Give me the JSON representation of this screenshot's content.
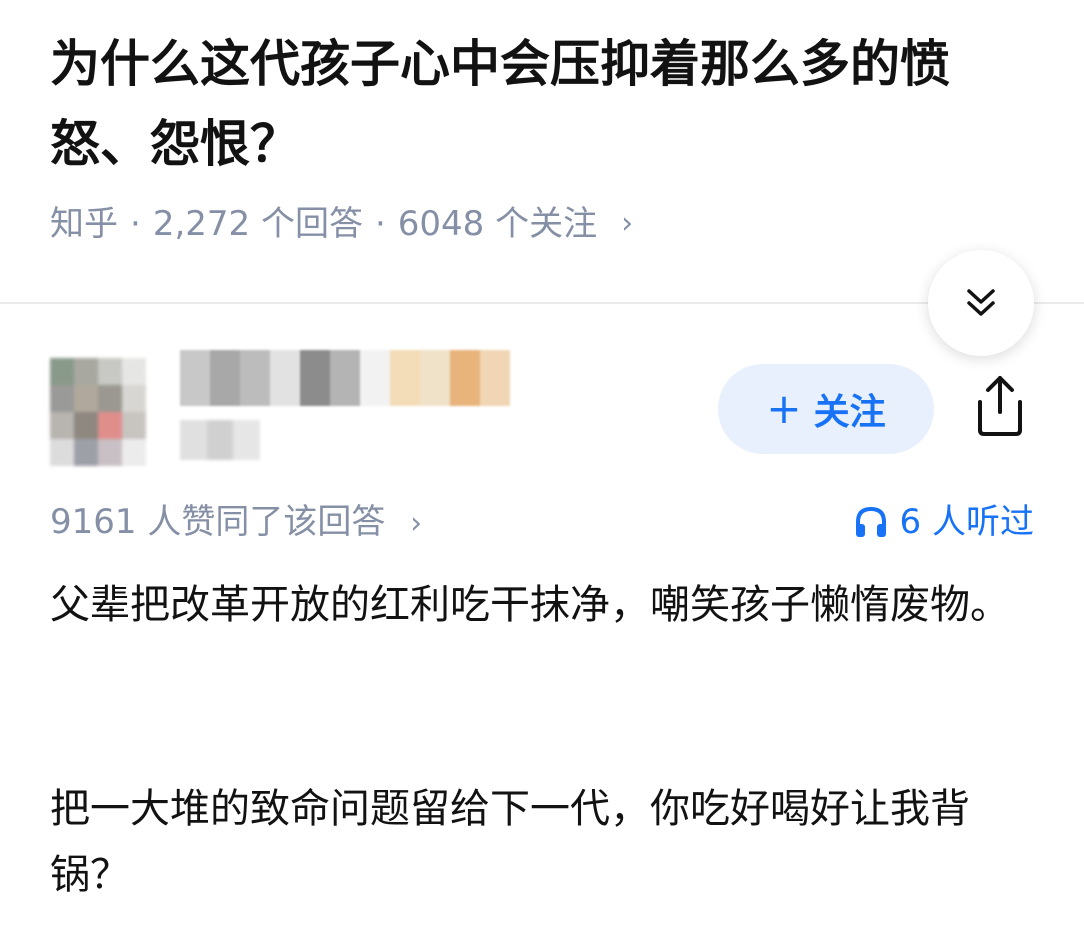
{
  "question": {
    "title": "为什么这代孩子心中会压抑着那么多的愤怒、怨恨？",
    "source": "知乎",
    "answers": "2,272 个回答",
    "followers": "6048 个关注",
    "separator": "·",
    "chevron": "›"
  },
  "author": {
    "follow_label": "关注",
    "follow_icon": "+",
    "share_icon": "share-icon",
    "collapse_icon": "double-chevron-down-icon"
  },
  "answer": {
    "vote_text": "9161 人赞同了该回答",
    "chevron": "›",
    "listen_text": "6 人听过",
    "listen_icon": "headphones-icon",
    "paragraphs": [
      "父辈把改革开放的红利吃干抹净，嘲笑孩子懒惰废物。",
      "把一大堆的致命问题留给下一代，你吃好喝好让我背锅？"
    ]
  },
  "colors": {
    "accent": "#1772f6",
    "follow_bg": "#e8f0fd",
    "meta_gray": "#8590a6",
    "text": "#121212"
  }
}
